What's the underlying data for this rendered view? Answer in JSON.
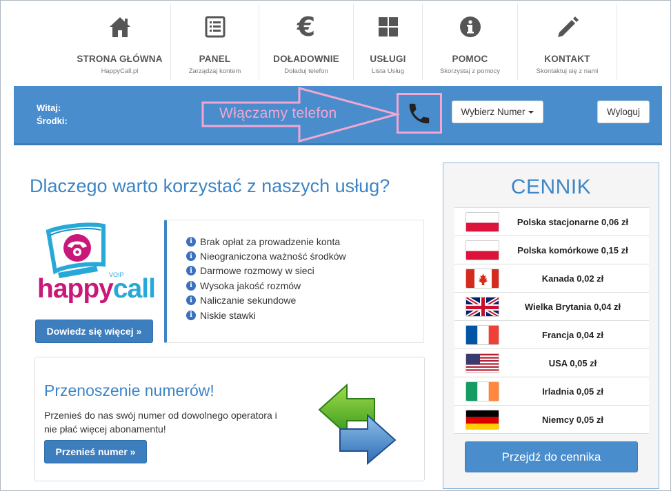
{
  "nav": [
    {
      "title": "STRONA GŁÓWNA",
      "sub": "HappyCall.pl",
      "icon": "home-icon"
    },
    {
      "title": "PANEL",
      "sub": "Zarządzaj kontem",
      "icon": "list-icon"
    },
    {
      "title": "DOŁADOWNIE",
      "sub": "Doładuj telefon",
      "icon": "euro-icon"
    },
    {
      "title": "USŁUGI",
      "sub": "Lista Usług",
      "icon": "grid-icon"
    },
    {
      "title": "POMOC",
      "sub": "Skorzystaj z pomocy",
      "icon": "info-icon"
    },
    {
      "title": "KONTAKT",
      "sub": "Skontaktuj się z nami",
      "icon": "pencil-icon"
    }
  ],
  "bar": {
    "greeting": "Witaj:",
    "balance": "Środki:",
    "annotation": "Włączamy telefon",
    "choose_number": "Wybierz Numer",
    "logout": "Wyloguj"
  },
  "main": {
    "headline": "Dlaczego warto korzystać z naszych usług?",
    "logo_text_happy": "happy",
    "logo_text_call": "call",
    "logo_voip": "VOIP",
    "learn_more": "Dowiedz się więcej »",
    "features": [
      "Brak opłat za prowadzenie konta",
      "Nieograniczona ważność środków",
      "Darmowe rozmowy w sieci",
      "Wysoka jakość rozmów",
      "Naliczanie sekundowe",
      "Niskie stawki"
    ]
  },
  "porting": {
    "title": "Przenoszenie numerów!",
    "text": "Przenieś do nas swój numer od dowolnego operatora i nie płać więcej abonamentu!",
    "button": "Przenieś numer »"
  },
  "cennik": {
    "title": "CENNIK",
    "rows": [
      {
        "label": "Polska stacjonarne 0,06 zł",
        "flag": "pl"
      },
      {
        "label": "Polska komórkowe 0,15 zł",
        "flag": "pl"
      },
      {
        "label": "Kanada 0,02 zł",
        "flag": "ca"
      },
      {
        "label": "Wielka Brytania 0,04 zł",
        "flag": "gb"
      },
      {
        "label": "Francja 0,04 zł",
        "flag": "fr"
      },
      {
        "label": "USA 0,05 zł",
        "flag": "us"
      },
      {
        "label": "Irladnia 0,05 zł",
        "flag": "ie"
      },
      {
        "label": "Niemcy 0,05 zł",
        "flag": "de"
      }
    ],
    "button": "Przejdź do cennika"
  },
  "colors": {
    "bar_blue": "#4a8dcc",
    "accent_blue": "#3d85c6",
    "annotation_pink": "#f4a6d2",
    "logo_magenta": "#c8197a"
  }
}
